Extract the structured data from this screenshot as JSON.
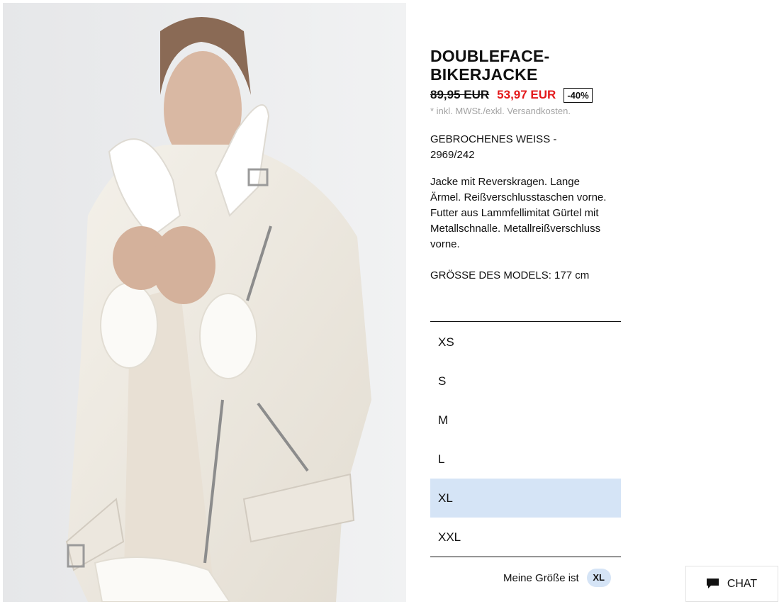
{
  "product": {
    "title_line1": "DOUBLEFACE-",
    "title_line2": "BIKERJACKE",
    "price_old": "89,95 EUR",
    "price_new": "53,97 EUR",
    "discount": "-40%",
    "tax_note": "* inkl. MWSt./exkl. Versandkosten.",
    "color_ref": "GEBROCHENES WEISS - 2969/242",
    "description": "Jacke mit Reverskragen. Lange Ärmel. Reißverschlusstaschen vorne. Futter aus Lammfellimitat Gürtel mit Metallschnalle. Metallreißverschluss vorne.",
    "model_size": "GRÖSSE DES MODELS: 177 cm"
  },
  "sizes": [
    {
      "label": "XS",
      "selected": false
    },
    {
      "label": "S",
      "selected": false
    },
    {
      "label": "M",
      "selected": false
    },
    {
      "label": "L",
      "selected": false
    },
    {
      "label": "XL",
      "selected": true
    },
    {
      "label": "XXL",
      "selected": false
    }
  ],
  "my_size": {
    "label": "Meine Größe ist",
    "value": "XL"
  },
  "chat": {
    "label": "CHAT",
    "icon": "chat-bubble-icon"
  },
  "colors": {
    "sale_red": "#e3191b",
    "selected_size_bg": "#d5e4f6",
    "text": "#111111",
    "muted": "#a3a3a3"
  }
}
